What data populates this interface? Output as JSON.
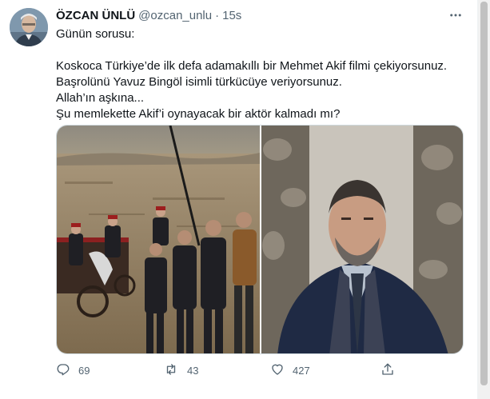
{
  "tweet": {
    "author_name": "ÖZCAN ÜNLÜ",
    "handle": "@ozcan_unlu",
    "separator": "·",
    "time": "15s",
    "lines": [
      "Günün sorusu:",
      "",
      "Koskoca Türkiye’de ilk defa adamakıllı bir Mehmet Akif filmi çekiyorsunuz.",
      "Başrolünü Yavuz Bingöl isimli türkücüye veriyorsunuz.",
      "Allah’ın aşkına...",
      "Şu memlekette Akif’i oynayacak bir aktör kalmadı mı?"
    ]
  },
  "actions": {
    "reply_count": "69",
    "retweet_count": "43",
    "like_count": "427"
  },
  "icons": {
    "more": "more-icon",
    "reply": "reply-icon",
    "retweet": "retweet-icon",
    "like": "heart-icon",
    "share": "share-icon"
  },
  "colors": {
    "text": "#0f1419",
    "secondary": "#536471",
    "border": "#cfd9de"
  }
}
